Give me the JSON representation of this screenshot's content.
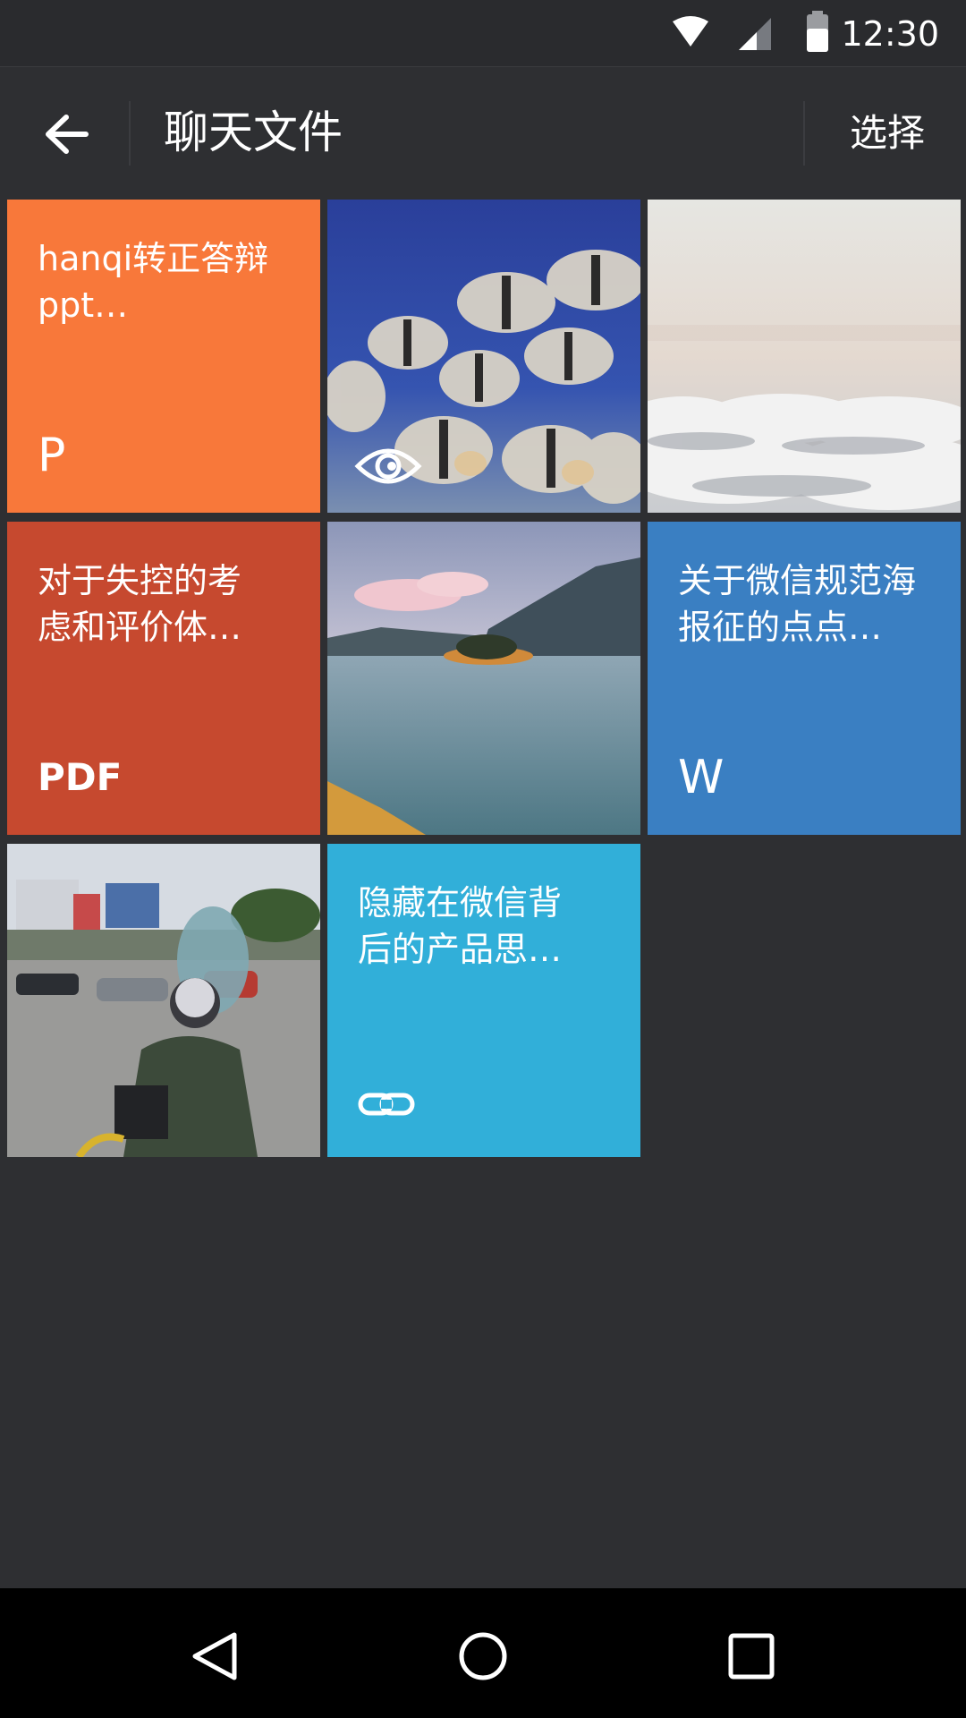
{
  "status_bar": {
    "time": "12:30"
  },
  "header": {
    "title": "聊天文件",
    "select_label": "选择"
  },
  "files": [
    {
      "kind": "document",
      "title": "hanqi转正答辩\nppt…",
      "type_label": "P",
      "color": "#f8783a"
    },
    {
      "kind": "video",
      "icon": "eye-icon",
      "scene": "aquarium-fish"
    },
    {
      "kind": "image",
      "scene": "sky-clouds"
    },
    {
      "kind": "document",
      "title": "对于失控的考\n虑和评价体…",
      "type_label": "PDF",
      "color": "#c6492f"
    },
    {
      "kind": "image",
      "scene": "lake-island"
    },
    {
      "kind": "document",
      "title": "关于微信规范海\n报征的点点…",
      "type_label": "W",
      "color": "#3a7fc2"
    },
    {
      "kind": "image",
      "scene": "street-motorcycle"
    },
    {
      "kind": "link",
      "title": "隐藏在微信背\n后的产品思…",
      "icon": "link-icon",
      "color": "#31afd9"
    }
  ],
  "colors": {
    "background": "#2e2f32",
    "nav_bar": "#000000"
  }
}
